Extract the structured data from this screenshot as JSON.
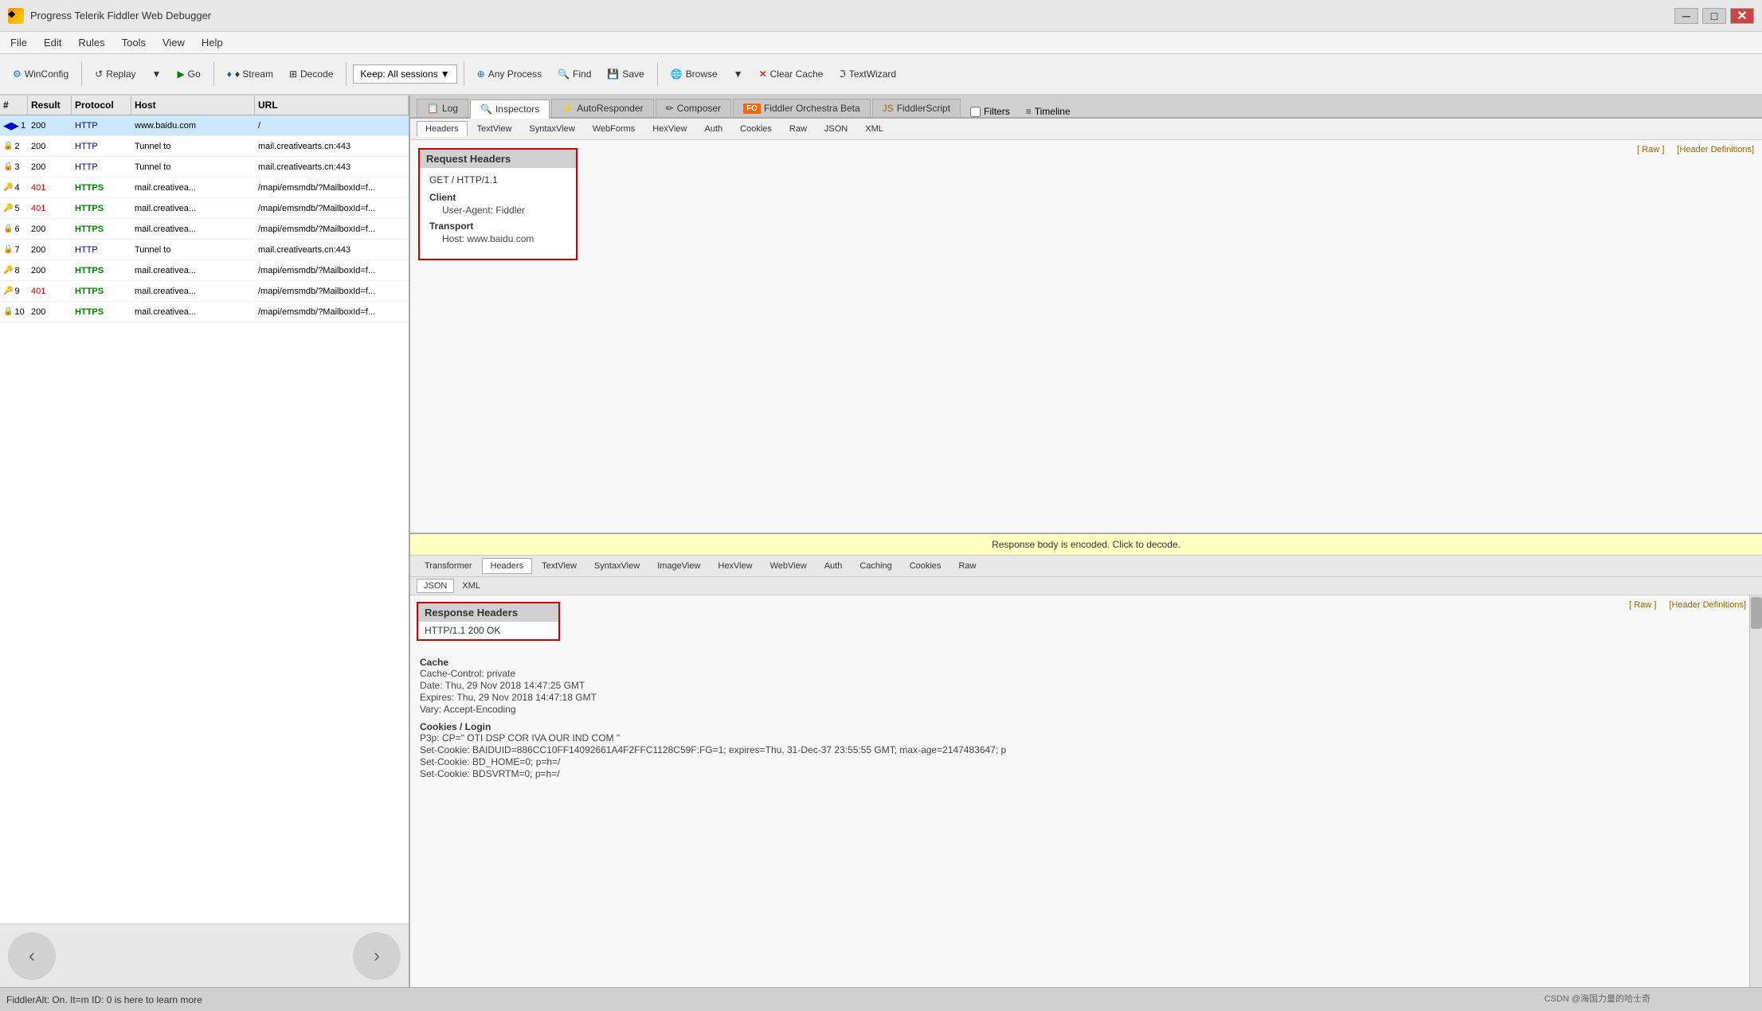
{
  "titleBar": {
    "icon": "◆",
    "title": "Progress Telerik Fiddler Web Debugger",
    "minimizeLabel": "─",
    "maximizeLabel": "□",
    "closeLabel": "✕"
  },
  "menuBar": {
    "items": [
      "File",
      "Edit",
      "Rules",
      "Tools",
      "View",
      "Help"
    ]
  },
  "toolbar": {
    "winconfig": "WinConfig",
    "replay": "↺ Replay",
    "go": "▶ Go",
    "stream": "♦ Stream",
    "decode": "⊞ Decode",
    "keep_label": "Keep: All sessions",
    "any_process": "⊕ Any Process",
    "find": "🔍 Find",
    "save": "💾 Save",
    "browse": "🌐 Browse",
    "clear_cache": "✕ Clear Cache",
    "text_wizard": "ℑ TextWizard"
  },
  "sessionTable": {
    "headers": [
      "#",
      "Result",
      "Protocol",
      "Host",
      "URL"
    ],
    "rows": [
      {
        "id": "1",
        "result": "200",
        "protocol": "HTTP",
        "host": "www.baidu.com",
        "url": "/",
        "selected": true,
        "iconType": "arrow",
        "status": "200"
      },
      {
        "id": "2",
        "result": "200",
        "protocol": "HTTP",
        "host": "Tunnel to",
        "url": "mail.creativearts.cn:443",
        "iconType": "lock",
        "status": "200"
      },
      {
        "id": "3",
        "result": "200",
        "protocol": "HTTP",
        "host": "Tunnel to",
        "url": "mail.creativearts.cn:443",
        "iconType": "lock",
        "status": "200"
      },
      {
        "id": "4",
        "result": "401",
        "protocol": "HTTPS",
        "host": "mail.creativea...",
        "url": "/mapi/emsmdb/?MailboxId=f...",
        "iconType": "key",
        "status": "401"
      },
      {
        "id": "5",
        "result": "401",
        "protocol": "HTTPS",
        "host": "mail.creativea...",
        "url": "/mapi/emsmdb/?MailboxId=f...",
        "iconType": "key",
        "status": "401"
      },
      {
        "id": "6",
        "result": "200",
        "protocol": "HTTPS",
        "host": "mail.creativea...",
        "url": "/mapi/emsmdb/?MailboxId=f...",
        "iconType": "lock-green",
        "status": "200"
      },
      {
        "id": "7",
        "result": "200",
        "protocol": "HTTP",
        "host": "Tunnel to",
        "url": "mail.creativearts.cn:443",
        "iconType": "lock",
        "status": "200"
      },
      {
        "id": "8",
        "result": "200",
        "protocol": "HTTPS",
        "host": "mail.creativea...",
        "url": "/mapi/emsmdb/?MailboxId=f...",
        "iconType": "key",
        "status": "200"
      },
      {
        "id": "9",
        "result": "401",
        "protocol": "HTTPS",
        "host": "mail.creativea...",
        "url": "/mapi/emsmdb/?MailboxId=f...",
        "iconType": "key",
        "status": "401"
      },
      {
        "id": "10",
        "result": "200",
        "protocol": "HTTPS",
        "host": "mail.creativea...",
        "url": "/mapi/emsmdb/?MailboxId=f...",
        "iconType": "lock-green",
        "status": "200"
      }
    ]
  },
  "rightPanel": {
    "topTabs": [
      "Log",
      "Inspectors",
      "AutoResponder",
      "Composer",
      "Fiddler Orchestra Beta",
      "FiddlerScript"
    ],
    "activeTopTab": "Inspectors",
    "inspectorTabs": [
      "Headers",
      "TextView",
      "SyntaxView",
      "WebForms",
      "HexView",
      "Auth",
      "Cookies",
      "Raw",
      "JSON",
      "XML"
    ],
    "activeInspectorTab": "Headers",
    "rawLink": "[ Raw ]",
    "headerDefLink": "[Header Definitions]",
    "requestSection": {
      "title": "Request Headers",
      "httpLine": "GET / HTTP/1.1",
      "sections": [
        {
          "label": "Client",
          "fields": [
            "User-Agent: Fiddler"
          ]
        },
        {
          "label": "Transport",
          "fields": [
            "Host: www.baidu.com"
          ]
        }
      ]
    },
    "responseEncodedBar": "Response body is encoded. Click to decode.",
    "responseTabs": [
      "Transformer",
      "Headers",
      "TextView",
      "SyntaxView",
      "ImageView",
      "HexView",
      "WebView",
      "Auth",
      "Caching",
      "Cookies",
      "Raw"
    ],
    "activeResponseTab": "Headers",
    "responseSubTabs": [
      "JSON",
      "XML"
    ],
    "responseSection": {
      "title": "Response Headers",
      "rawLink": "[ Raw ]",
      "headerDefLink": "[Header Definitions]",
      "httpLine": "HTTP/1.1 200 OK",
      "cacheSection": {
        "label": "Cache",
        "fields": [
          "Cache-Control: private",
          "Date: Thu, 29 Nov 2018 14:47:25 GMT",
          "Expires: Thu, 29 Nov 2018 14:47:18 GMT",
          "Vary: Accept-Encoding"
        ]
      },
      "cookiesSection": {
        "label": "Cookies / Login",
        "fields": [
          "P3p: CP=\" OTI DSP COR IVA OUR IND COM \"",
          "Set-Cookie: BAIDUID=886CC10FF14092661A4F2FFC1128C59F:FG=1; expires=Thu, 31-Dec-37 23:55:55 GMT; max-age=2147483647; p",
          "Set-Cookie: BD_HOME=0; p=h=/",
          "Set-Cookie: BDSVRTM=0; p=h=/"
        ]
      }
    }
  },
  "statusBar": {
    "leftText": "FiddlerAlt: On. It=m ID: 0 is here to learn more"
  },
  "watermark": "CSDN @海国力量的哈士奇"
}
